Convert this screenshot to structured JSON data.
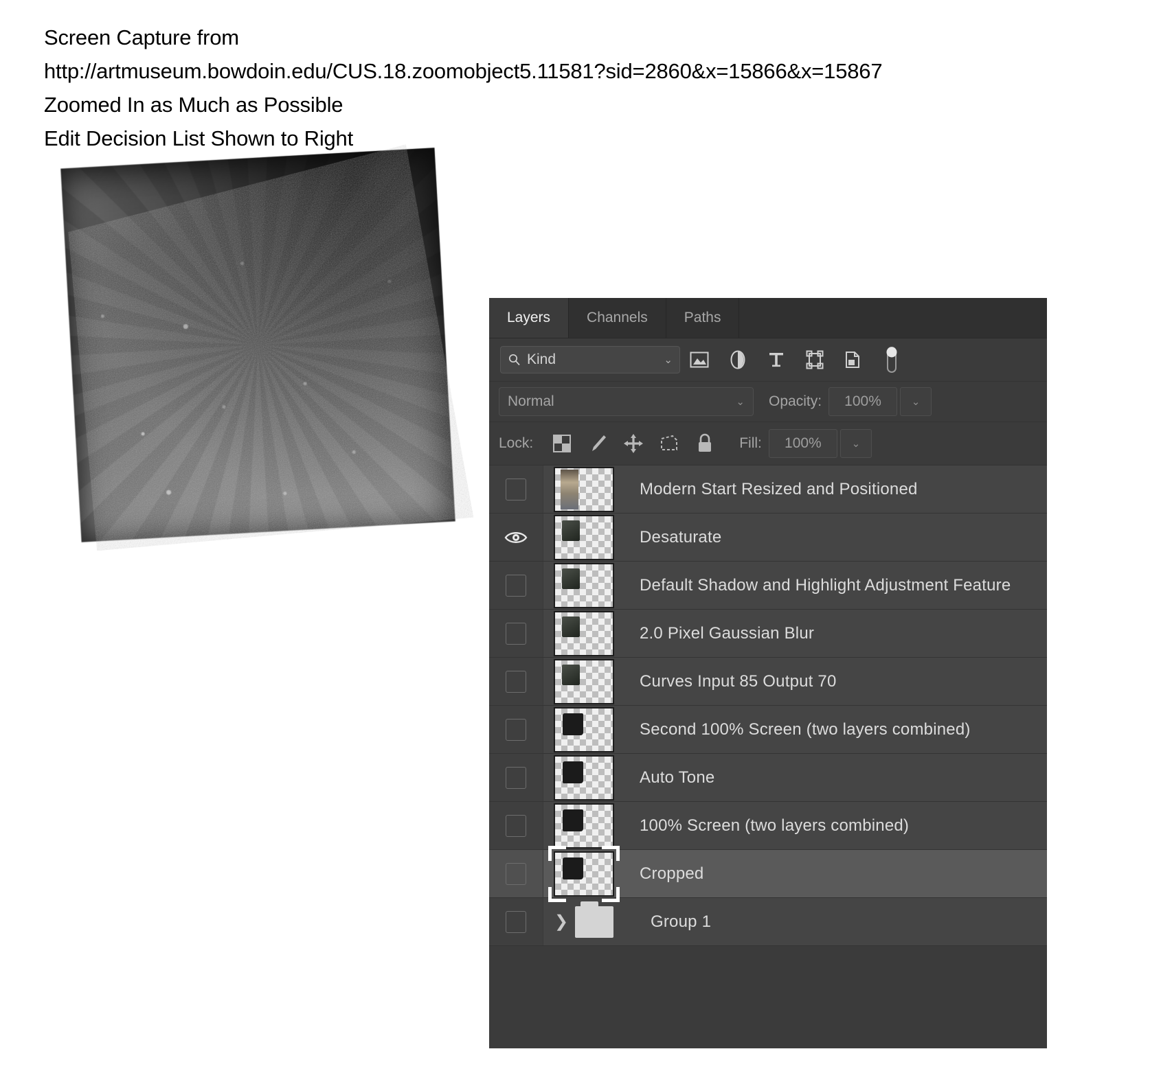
{
  "caption": {
    "line1": "Screen Capture from",
    "line2": "http://artmuseum.bowdoin.edu/CUS.18.zoomobject5.11581?sid=2860&x=15866&x=15867",
    "line3": "Zoomed In as Much as Possible",
    "line4": "Edit Decision List Shown to Right"
  },
  "artwork": {
    "alt_name": "zoomed-grayscale-photo-detail"
  },
  "panel": {
    "tabs": [
      {
        "label": "Layers",
        "active": true
      },
      {
        "label": "Channels",
        "active": false
      },
      {
        "label": "Paths",
        "active": false
      }
    ],
    "filter": {
      "kind_label": "Kind",
      "search_icon": "search-icon",
      "chevron": "⌄",
      "icons": [
        "pixel-layer-filter-icon",
        "adjustment-layer-filter-icon",
        "type-layer-filter-icon",
        "shape-layer-filter-icon",
        "smart-object-filter-icon",
        "filter-toggle-switch"
      ]
    },
    "blend": {
      "mode": "Normal",
      "chevron": "⌄",
      "opacity_label": "Opacity:",
      "opacity_value": "100%"
    },
    "lock": {
      "label": "Lock:",
      "icons": [
        "lock-transparent-pixels-icon",
        "lock-image-pixels-icon",
        "lock-position-icon",
        "lock-artboard-nesting-icon",
        "lock-all-icon"
      ],
      "fill_label": "Fill:",
      "fill_value": "100%"
    },
    "layers": [
      {
        "name": "Modern Start Resized and Positioned",
        "visible": false,
        "selected": false,
        "type": "pixel",
        "thumb": "portrait"
      },
      {
        "name": "Desaturate",
        "visible": true,
        "selected": false,
        "type": "pixel",
        "thumb": "small-dark"
      },
      {
        "name": "Default Shadow and Highlight Adjustment Feature",
        "visible": false,
        "selected": false,
        "type": "pixel",
        "thumb": "small-dark"
      },
      {
        "name": "2.0 Pixel Gaussian Blur",
        "visible": false,
        "selected": false,
        "type": "pixel",
        "thumb": "small-dark"
      },
      {
        "name": "Curves Input 85 Output 70",
        "visible": false,
        "selected": false,
        "type": "pixel",
        "thumb": "small-dark"
      },
      {
        "name": "Second 100% Screen (two layers combined)",
        "visible": false,
        "selected": false,
        "type": "pixel",
        "thumb": "black-blob"
      },
      {
        "name": "Auto Tone",
        "visible": false,
        "selected": false,
        "type": "pixel",
        "thumb": "black-blob"
      },
      {
        "name": "100% Screen (two layers combined)",
        "visible": false,
        "selected": false,
        "type": "pixel",
        "thumb": "black-blob"
      },
      {
        "name": "Cropped",
        "visible": false,
        "selected": true,
        "type": "pixel",
        "thumb": "black-blob"
      },
      {
        "name": "Group 1",
        "visible": false,
        "selected": false,
        "type": "group",
        "thumb": "folder"
      }
    ]
  },
  "colors": {
    "panel_bg": "#3b3b3b",
    "row_bg": "#454545",
    "row_selected_bg": "#5a5a5a",
    "tab_bg": "#303030",
    "text": "#dcdcdc",
    "muted_text": "#a5a5a5"
  }
}
